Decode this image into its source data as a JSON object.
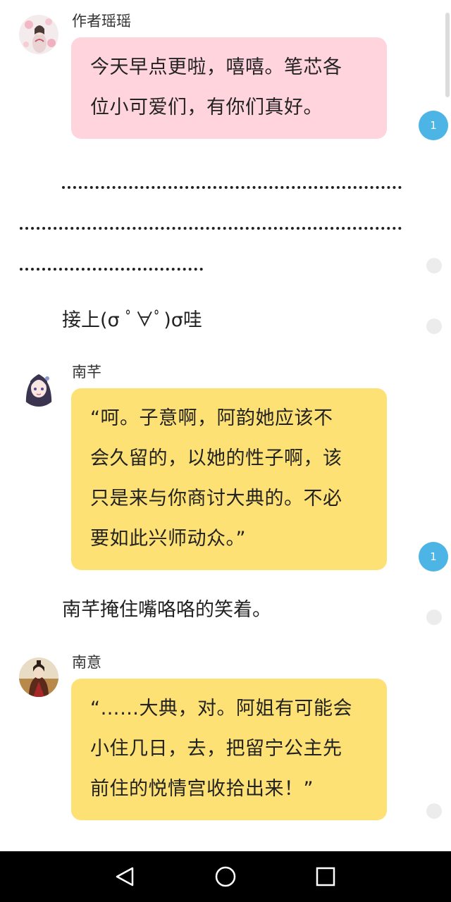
{
  "messages": {
    "m1": {
      "speaker": "作者瑶瑶",
      "lines": [
        "今天早点更啦，嘻嘻。笔芯各",
        "位小可爱们，有你们真好。"
      ],
      "comment_count": "1"
    },
    "m2": {
      "text": "接上(σ ﾟ∀ﾟ)σ哇"
    },
    "m3": {
      "speaker": "南芊",
      "lines": [
        "“呵。子意啊，阿韵她应该不",
        "会久留的，以她的性子啊，该",
        "只是来与你商讨大典的。不必",
        "要如此兴师动众。”"
      ],
      "comment_count": "1"
    },
    "m4": {
      "text": "南芊掩住嘴咯咯的笑着。"
    },
    "m5": {
      "speaker": "南意",
      "lines": [
        "“……大典，对。阿姐有可能会",
        "小住几日，去，把留宁公主先",
        "前住的悦情宫收拾出来！”"
      ]
    }
  },
  "colors": {
    "author_bubble": "#ffd4dd",
    "character_bubble": "#fde174",
    "comment_badge": "#4cb5e6"
  },
  "nav": {
    "back": "back-triangle-icon",
    "home": "home-circle-icon",
    "recents": "recents-square-icon"
  }
}
